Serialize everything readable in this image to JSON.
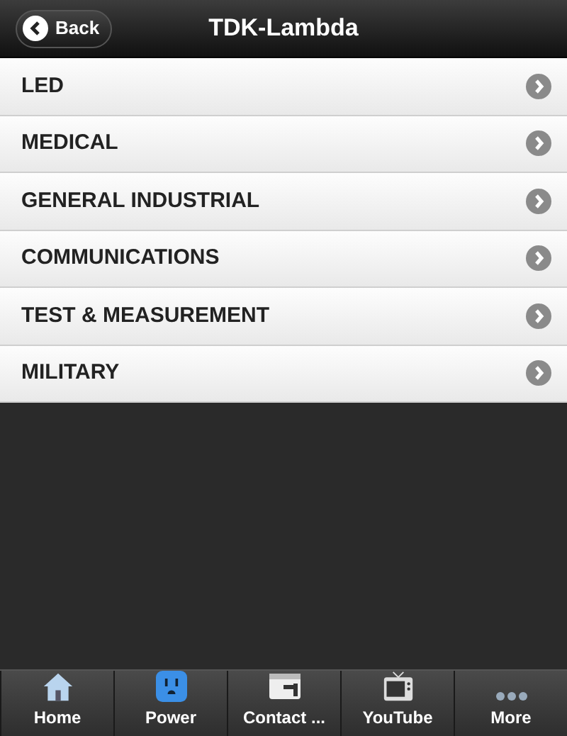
{
  "header": {
    "back_label": "Back",
    "title": "TDK-Lambda"
  },
  "items": [
    {
      "label": "LED"
    },
    {
      "label": "MEDICAL"
    },
    {
      "label": "GENERAL INDUSTRIAL"
    },
    {
      "label": "COMMUNICATIONS"
    },
    {
      "label": "TEST & MEASUREMENT"
    },
    {
      "label": "MILITARY"
    }
  ],
  "tabs": [
    {
      "label": "Home",
      "kind": "home"
    },
    {
      "label": "Power",
      "kind": "power"
    },
    {
      "label": "Contact ...",
      "kind": "contact"
    },
    {
      "label": "YouTube",
      "kind": "tv"
    },
    {
      "label": "More",
      "kind": "more"
    }
  ]
}
